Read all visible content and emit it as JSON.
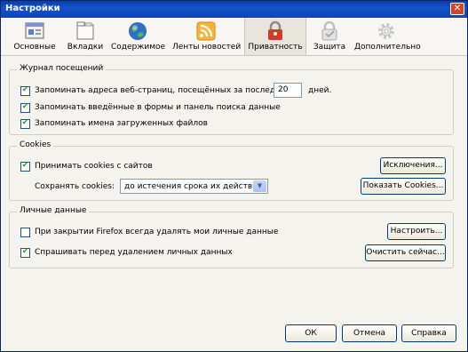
{
  "window": {
    "title": "Настройки",
    "close_label": "✕"
  },
  "toolbar": {
    "tabs": [
      {
        "label": "Основные",
        "icon": "general-icon"
      },
      {
        "label": "Вкладки",
        "icon": "tabs-icon"
      },
      {
        "label": "Содержимое",
        "icon": "content-icon"
      },
      {
        "label": "Ленты новостей",
        "icon": "feeds-icon"
      },
      {
        "label": "Приватность",
        "icon": "privacy-icon"
      },
      {
        "label": "Защита",
        "icon": "security-icon"
      },
      {
        "label": "Дополнительно",
        "icon": "advanced-icon"
      }
    ],
    "selected": "Приватность"
  },
  "history": {
    "legend": "Журнал посещений",
    "remember_pages_label": "Запоминать адреса веб-страниц, посещённых за последние",
    "days_value": "20",
    "days_label": "дней.",
    "remember_forms_label": "Запоминать введённые в формы и панель поиска данные",
    "remember_downloads_label": "Запоминать имена загруженных файлов",
    "remember_pages_checked": true,
    "remember_forms_checked": true,
    "remember_downloads_checked": true
  },
  "cookies": {
    "legend": "Cookies",
    "accept_label": "Принимать cookies с сайтов",
    "accept_checked": true,
    "exceptions_button": "Исключения...",
    "keep_label": "Сохранять cookies:",
    "keep_value": "до истечения срока их действия",
    "show_button": "Показать Cookies..."
  },
  "private_data": {
    "legend": "Личные данные",
    "clear_on_close_label": "При закрытии Firefox всегда удалять мои личные данные",
    "clear_on_close_checked": false,
    "settings_button": "Настроить...",
    "ask_label": "Спрашивать перед удалением личных данных",
    "ask_checked": true,
    "clear_now_button": "Очистить сейчас..."
  },
  "footer": {
    "ok": "ОК",
    "cancel": "Отмена",
    "help": "Справка"
  },
  "check_mark": "✔"
}
